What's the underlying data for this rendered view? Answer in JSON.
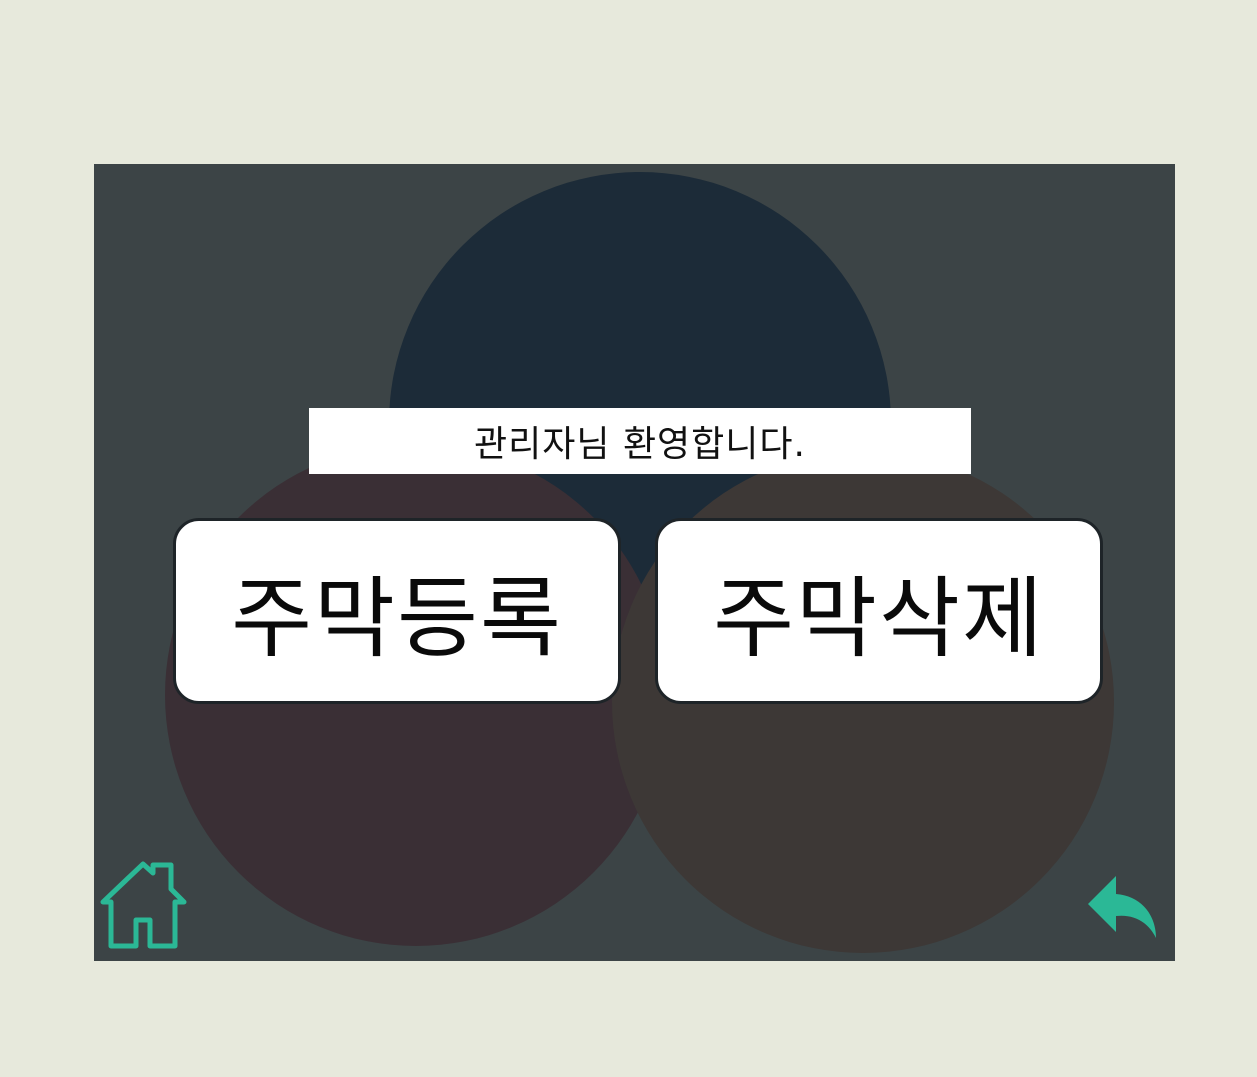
{
  "colors": {
    "page_background": "#e7e9dc",
    "panel_background": "#3c4446",
    "circle_top": "#1c2b38",
    "circle_left": "#3a2f35",
    "circle_right": "#3d3836",
    "accent": "#2bb896"
  },
  "welcome": {
    "text": "관리자님 환영합니다."
  },
  "menu": {
    "register_label": "주막등록",
    "delete_label": "주막삭제"
  },
  "icons": {
    "home": "home-icon",
    "back": "back-arrow-icon"
  }
}
